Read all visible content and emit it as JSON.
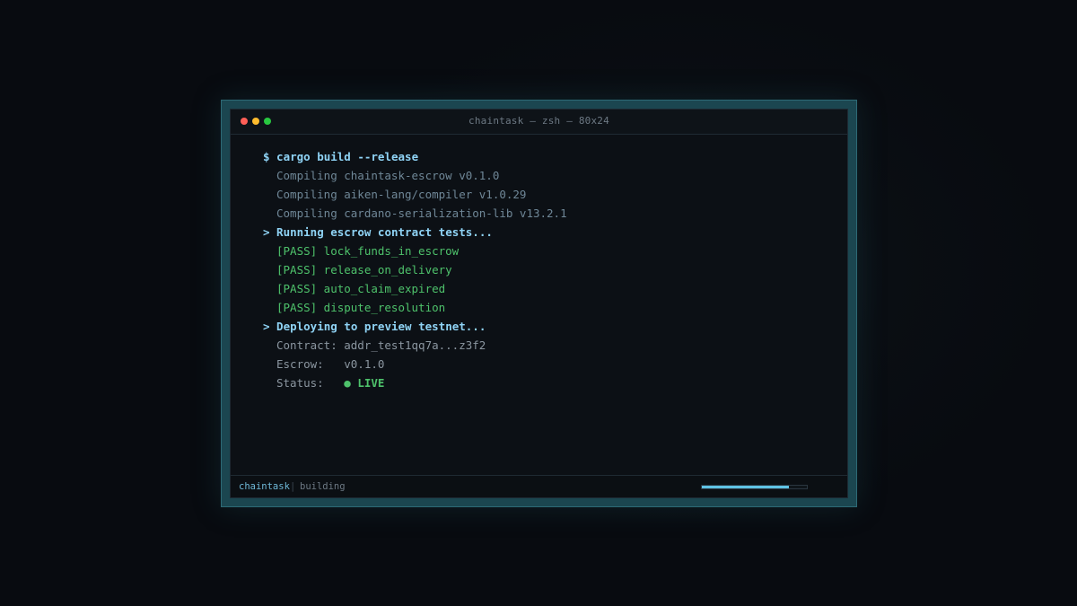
{
  "window": {
    "title": "chaintask — zsh — 80x24"
  },
  "terminal": {
    "lines": [
      {
        "kind": "cmd",
        "text": "$ cargo build --release"
      },
      {
        "kind": "dim",
        "text": "Compiling chaintask-escrow v0.1.0"
      },
      {
        "kind": "dim",
        "text": "Compiling aiken-lang/compiler v1.0.29"
      },
      {
        "kind": "dim",
        "text": "Compiling cardano-serialization-lib v13.2.1"
      },
      {
        "kind": "step",
        "text": "> Running escrow contract tests..."
      },
      {
        "kind": "pass",
        "text": "[PASS] lock_funds_in_escrow"
      },
      {
        "kind": "pass",
        "text": "[PASS] release_on_delivery"
      },
      {
        "kind": "pass",
        "text": "[PASS] auto_claim_expired"
      },
      {
        "kind": "pass",
        "text": "[PASS] dispute_resolution"
      },
      {
        "kind": "step",
        "text": "> Deploying to preview testnet..."
      },
      {
        "kind": "info",
        "text": "Contract: addr_test1qq7a...z3f2"
      },
      {
        "kind": "info",
        "text": "Escrow:   v0.1.0"
      }
    ],
    "status_label": "Status:   ",
    "status_value": "● LIVE"
  },
  "statusbar": {
    "name": "chaintask",
    "separator": "|",
    "state": "building",
    "progress": 0.83
  },
  "colors": {
    "accent": "#8fd3f5",
    "pass": "#4ec26b",
    "frame": "#1b4650"
  }
}
